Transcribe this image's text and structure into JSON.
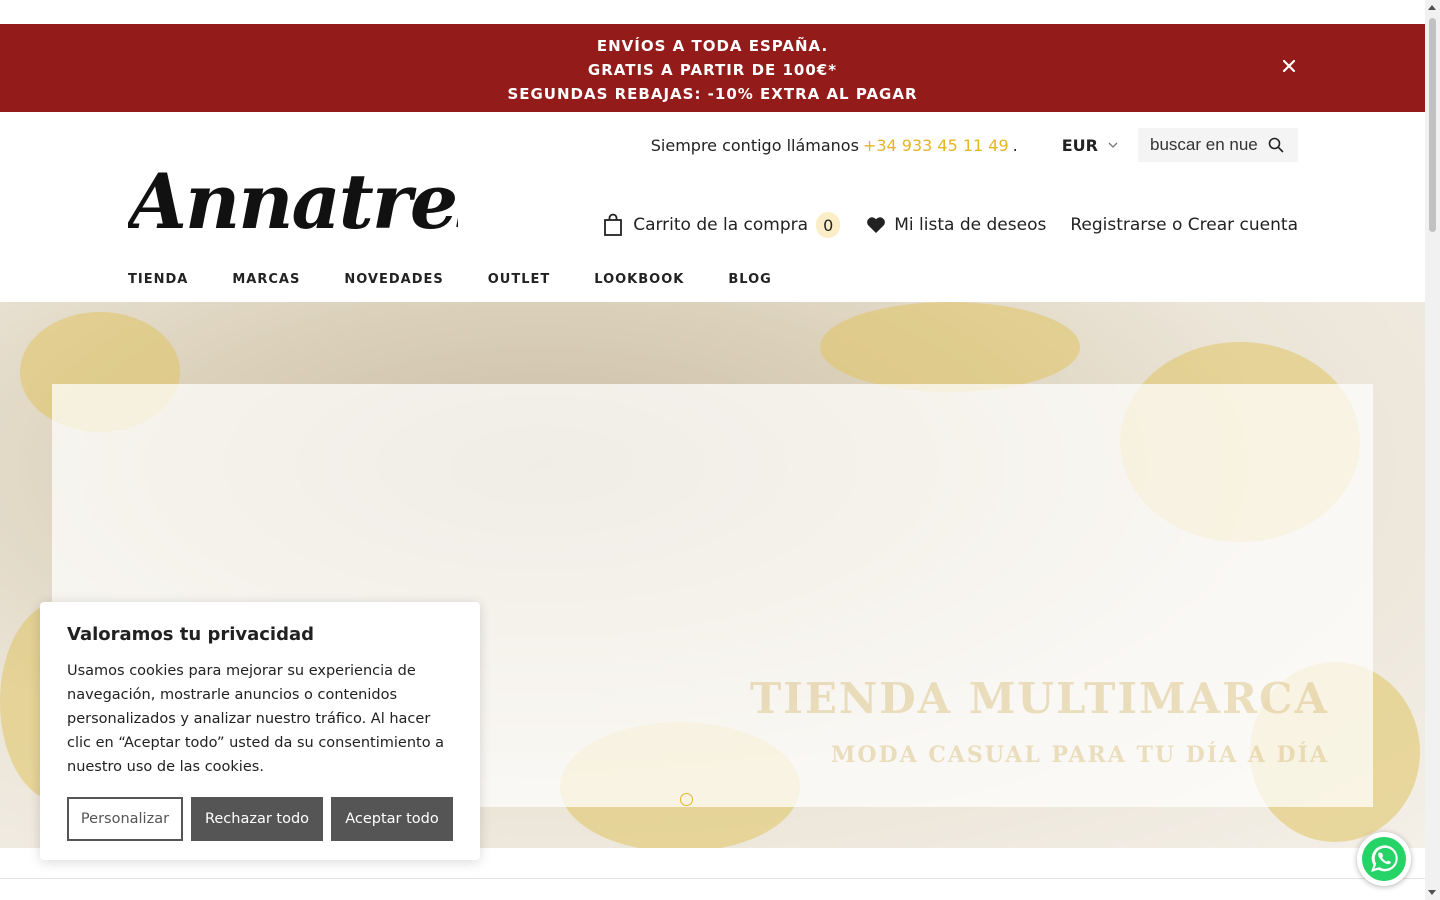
{
  "announcement": {
    "lines": [
      "ENVÍOS A TODA ESPAÑA.",
      "GRATIS A PARTIR DE 100€*",
      "SEGUNDAS REBAJAS: -10% EXTRA AL PAGAR"
    ],
    "close_icon": "close-icon"
  },
  "header": {
    "logo_text": "Annatres",
    "call_text": "Siempre contigo llámanos",
    "phone": "+34 933 45 11 49",
    "phone_suffix": ".",
    "currency": "EUR",
    "search_placeholder": "buscar en nuestra tienda",
    "cart_label": "Carrito de la compra",
    "cart_count": "0",
    "wishlist_label": "Mi lista de deseos",
    "account_label": "Registrarse o Crear cuenta"
  },
  "nav": {
    "items": [
      "TIENDA",
      "MARCAS",
      "NOVEDADES",
      "OUTLET",
      "LOOKBOOK",
      "BLOG"
    ]
  },
  "hero": {
    "title": "TIENDA MULTIMARCA",
    "subtitle": "MODA CASUAL PARA TU DÍA A DÍA"
  },
  "cookie": {
    "title": "Valoramos tu privacidad",
    "text": "Usamos cookies para mejorar su experiencia de navegación, mostrarle anuncios o contenidos personalizados y analizar nuestro tráfico. Al hacer clic en “Aceptar todo” usted da su consentimiento a nuestro uso de las cookies.",
    "customize": "Personalizar",
    "reject": "Rechazar todo",
    "accept": "Aceptar todo"
  },
  "colors": {
    "banner": "#931b1a",
    "accent": "#e6b32a",
    "button": "#555555"
  }
}
